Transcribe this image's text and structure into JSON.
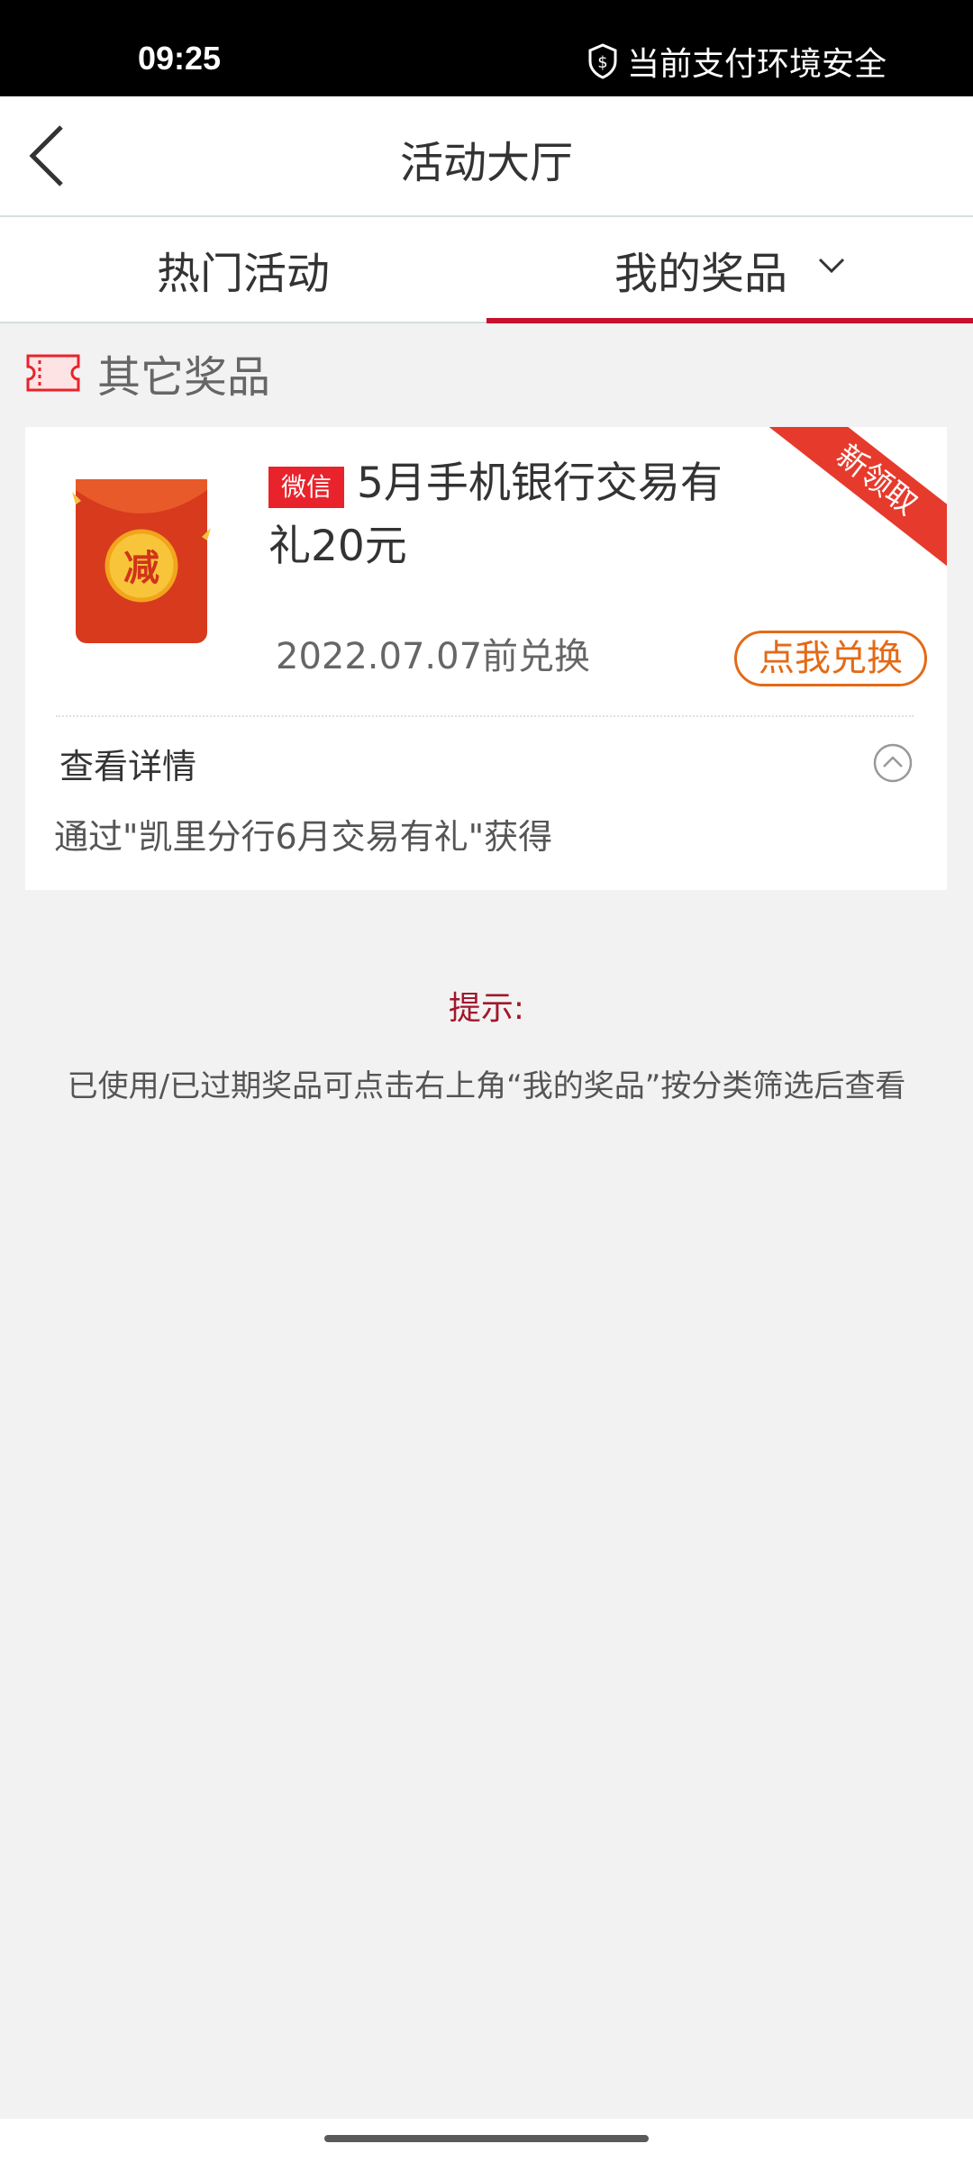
{
  "status_bar": {
    "time": "09:25",
    "security_text": "当前支付环境安全",
    "security_icon": "shield-dollar-icon"
  },
  "nav": {
    "title": "活动大厅",
    "back_icon": "chevron-left-icon"
  },
  "tabs": {
    "hot": "热门活动",
    "prizes": "我的奖品",
    "active": "prizes",
    "accent_color": "#c8102e"
  },
  "section": {
    "title": "其它奖品",
    "icon": "ticket-icon"
  },
  "prize": {
    "tag": "微信",
    "title_line1": "5月手机银行交易有",
    "title_line2": "礼20元",
    "expire": "2022.07.07前兑换",
    "redeem_label": "点我兑换",
    "ribbon": "新领取",
    "envelope_char": "减",
    "details_label": "查看详情",
    "source": "通过\"凯里分行6月交易有礼\"获得"
  },
  "tip": {
    "title": "提示:",
    "text": "已使用/已过期奖品可点击右上角“我的奖品”按分类筛选后查看"
  },
  "colors": {
    "ribbon": "#e63a2c",
    "redeem": "#e46a16",
    "tag": "#e8232c",
    "tip_title": "#a3172a"
  }
}
